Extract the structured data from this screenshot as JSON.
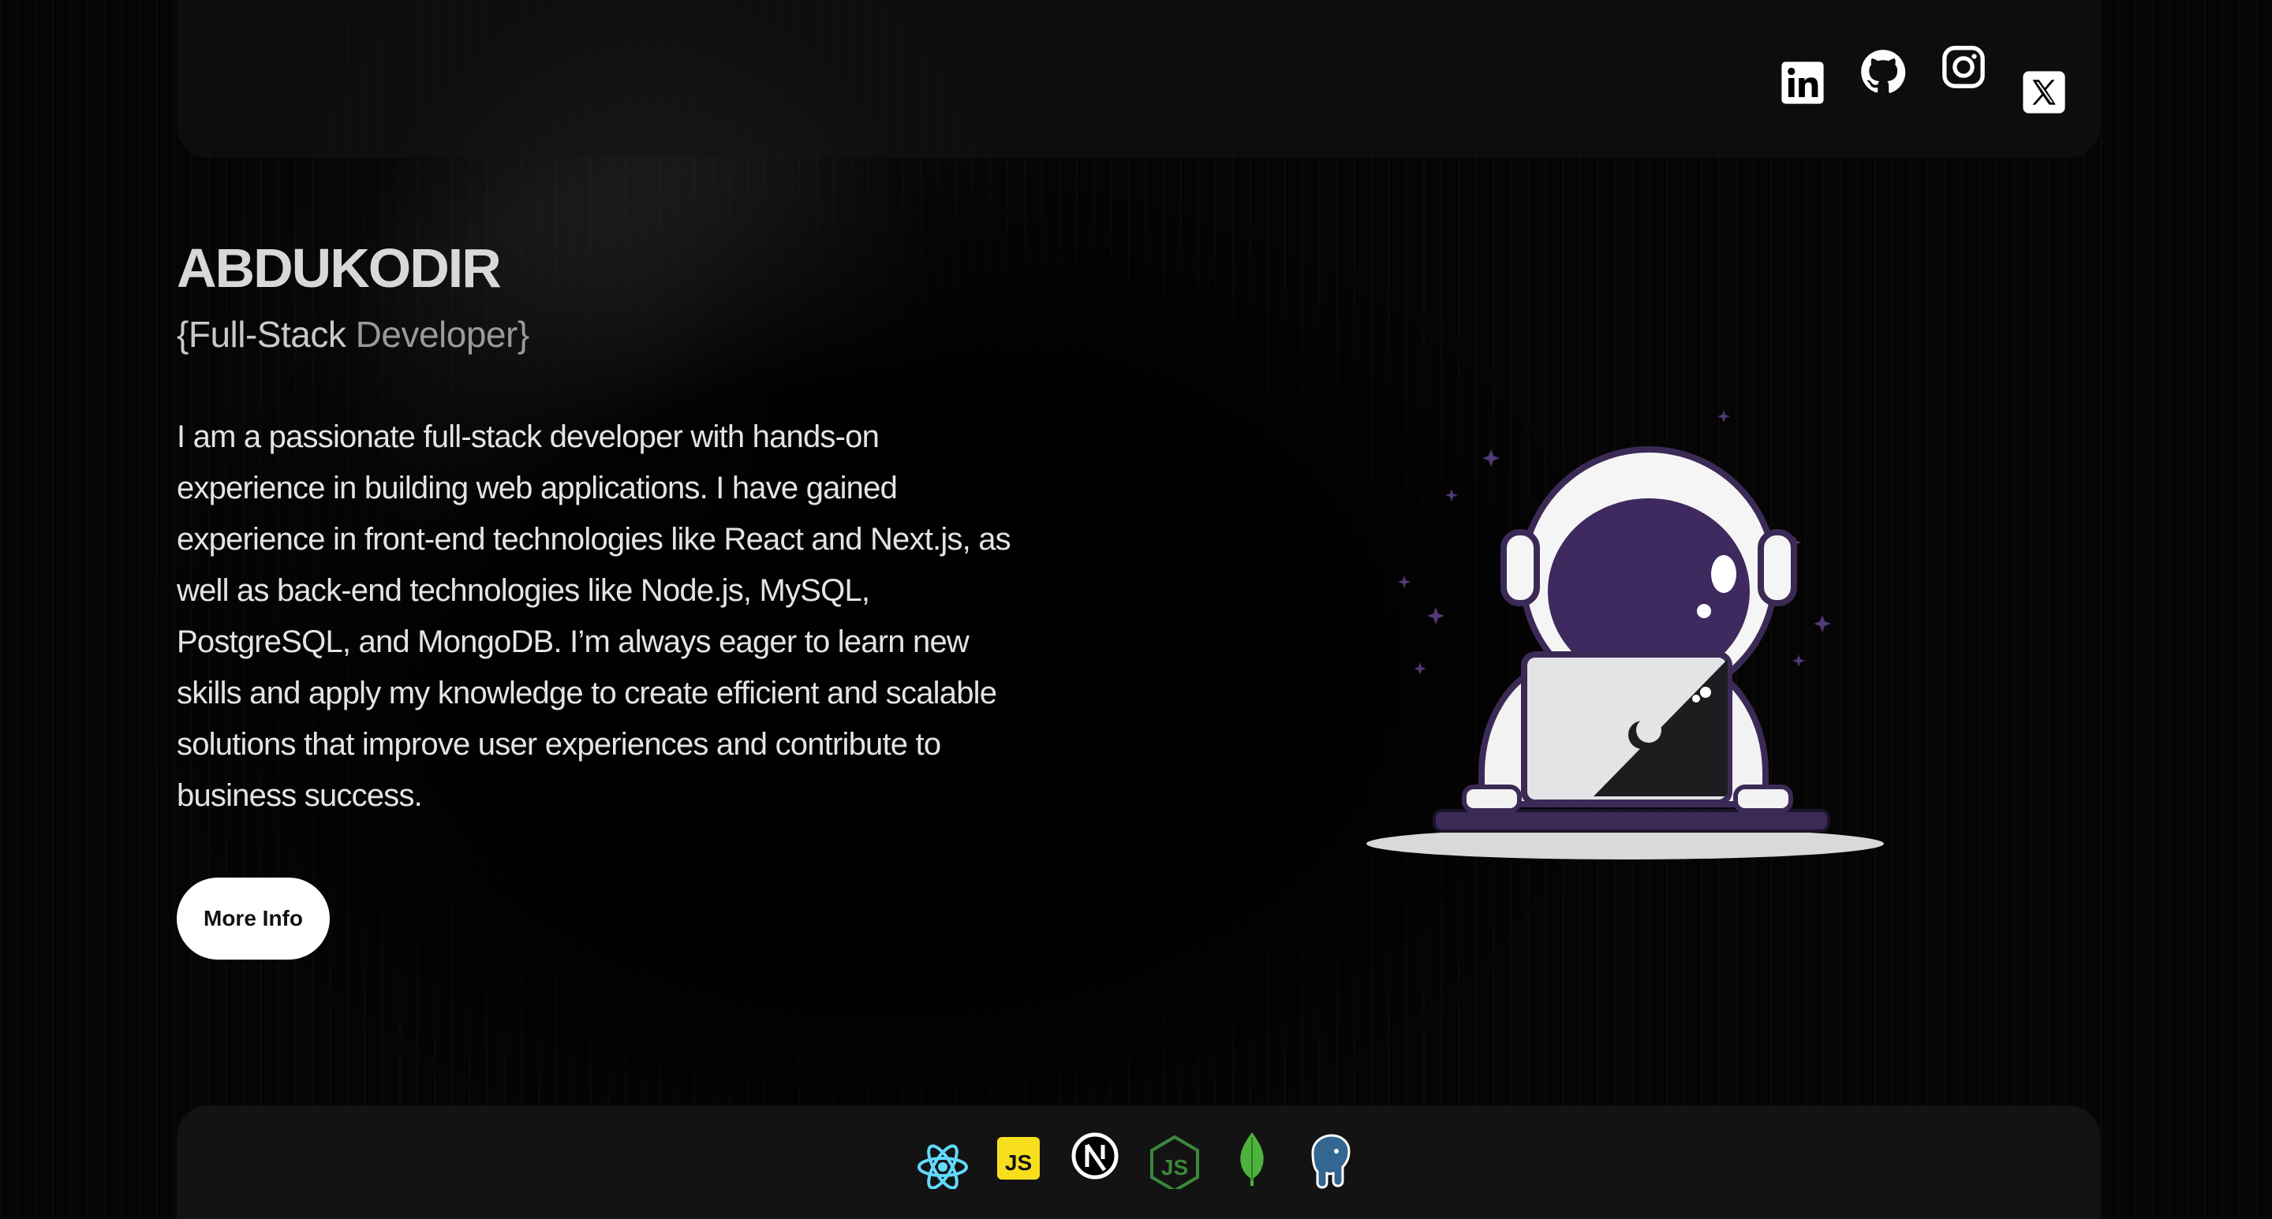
{
  "social": [
    {
      "name": "linkedin",
      "icon": "linkedin-icon"
    },
    {
      "name": "github",
      "icon": "github-icon"
    },
    {
      "name": "instagram",
      "icon": "instagram-icon"
    },
    {
      "name": "x",
      "icon": "x-icon"
    }
  ],
  "hero": {
    "name": "ABDUKODIR",
    "role_part1": "{Full-Stack",
    "role_part2": " Developer}",
    "bio": "I am a passionate full-stack developer with hands-on experience in building web applications. I have gained experience in front-end technologies like React and Next.js, as well as back-end technologies like Node.js, MySQL, PostgreSQL, and MongoDB. I’m always eager to learn new skills and apply my knowledge to create efficient and scalable solutions that improve user experiences and contribute to business success.",
    "button_label": "More Info"
  },
  "illustration": {
    "icon": "astronaut-laptop-illustration"
  },
  "tech_stack": [
    {
      "name": "react",
      "icon": "react-icon",
      "color": "#61DAFB"
    },
    {
      "name": "javascript",
      "icon": "javascript-icon",
      "color": "#F7DF1E",
      "label": "JS"
    },
    {
      "name": "nextjs",
      "icon": "nextjs-icon",
      "color": "#FFFFFF"
    },
    {
      "name": "nodejs",
      "icon": "nodejs-icon",
      "color": "#3C873A",
      "label": "JS"
    },
    {
      "name": "mongodb",
      "icon": "mongodb-icon",
      "color": "#4DB33D"
    },
    {
      "name": "postgresql",
      "icon": "postgresql-icon",
      "color": "#336791"
    }
  ]
}
